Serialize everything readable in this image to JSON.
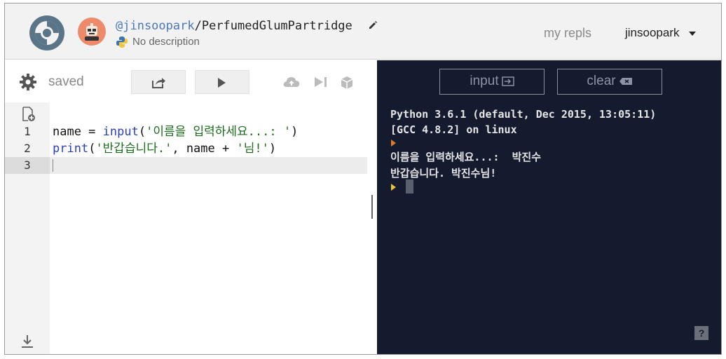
{
  "header": {
    "owner": "@jinsoopark",
    "separator": "/",
    "repl_name": "PerfumedGlumPartridge",
    "description": "No description",
    "my_repls": "my repls",
    "username": "jinsoopark"
  },
  "editor": {
    "status": "saved",
    "lines": [
      {
        "num": "1"
      },
      {
        "num": "2"
      },
      {
        "num": "3"
      }
    ],
    "line1": {
      "a": "name = ",
      "b": "input",
      "c": "(",
      "d": "'이름을 입력하세요...: '",
      "e": ")"
    },
    "line2": {
      "a": "print",
      "b": "(",
      "c": "'반갑습니다.'",
      "d": ", name + ",
      "e": "'님!'",
      "f": ")"
    }
  },
  "console": {
    "input_label": "input",
    "clear_label": "clear",
    "line1": "Python 3.6.1 (default, Dec 2015, 13:05:11)",
    "line2": "[GCC 4.8.2] on linux",
    "line3": "이름을 입력하세요...:  박진수",
    "line4": "반갑습니다. 박진수님!",
    "help": "?"
  },
  "colors": {
    "console_bg": "#151b2e",
    "avatar": "#ee8a6a",
    "username_link": "#4a78b8"
  }
}
